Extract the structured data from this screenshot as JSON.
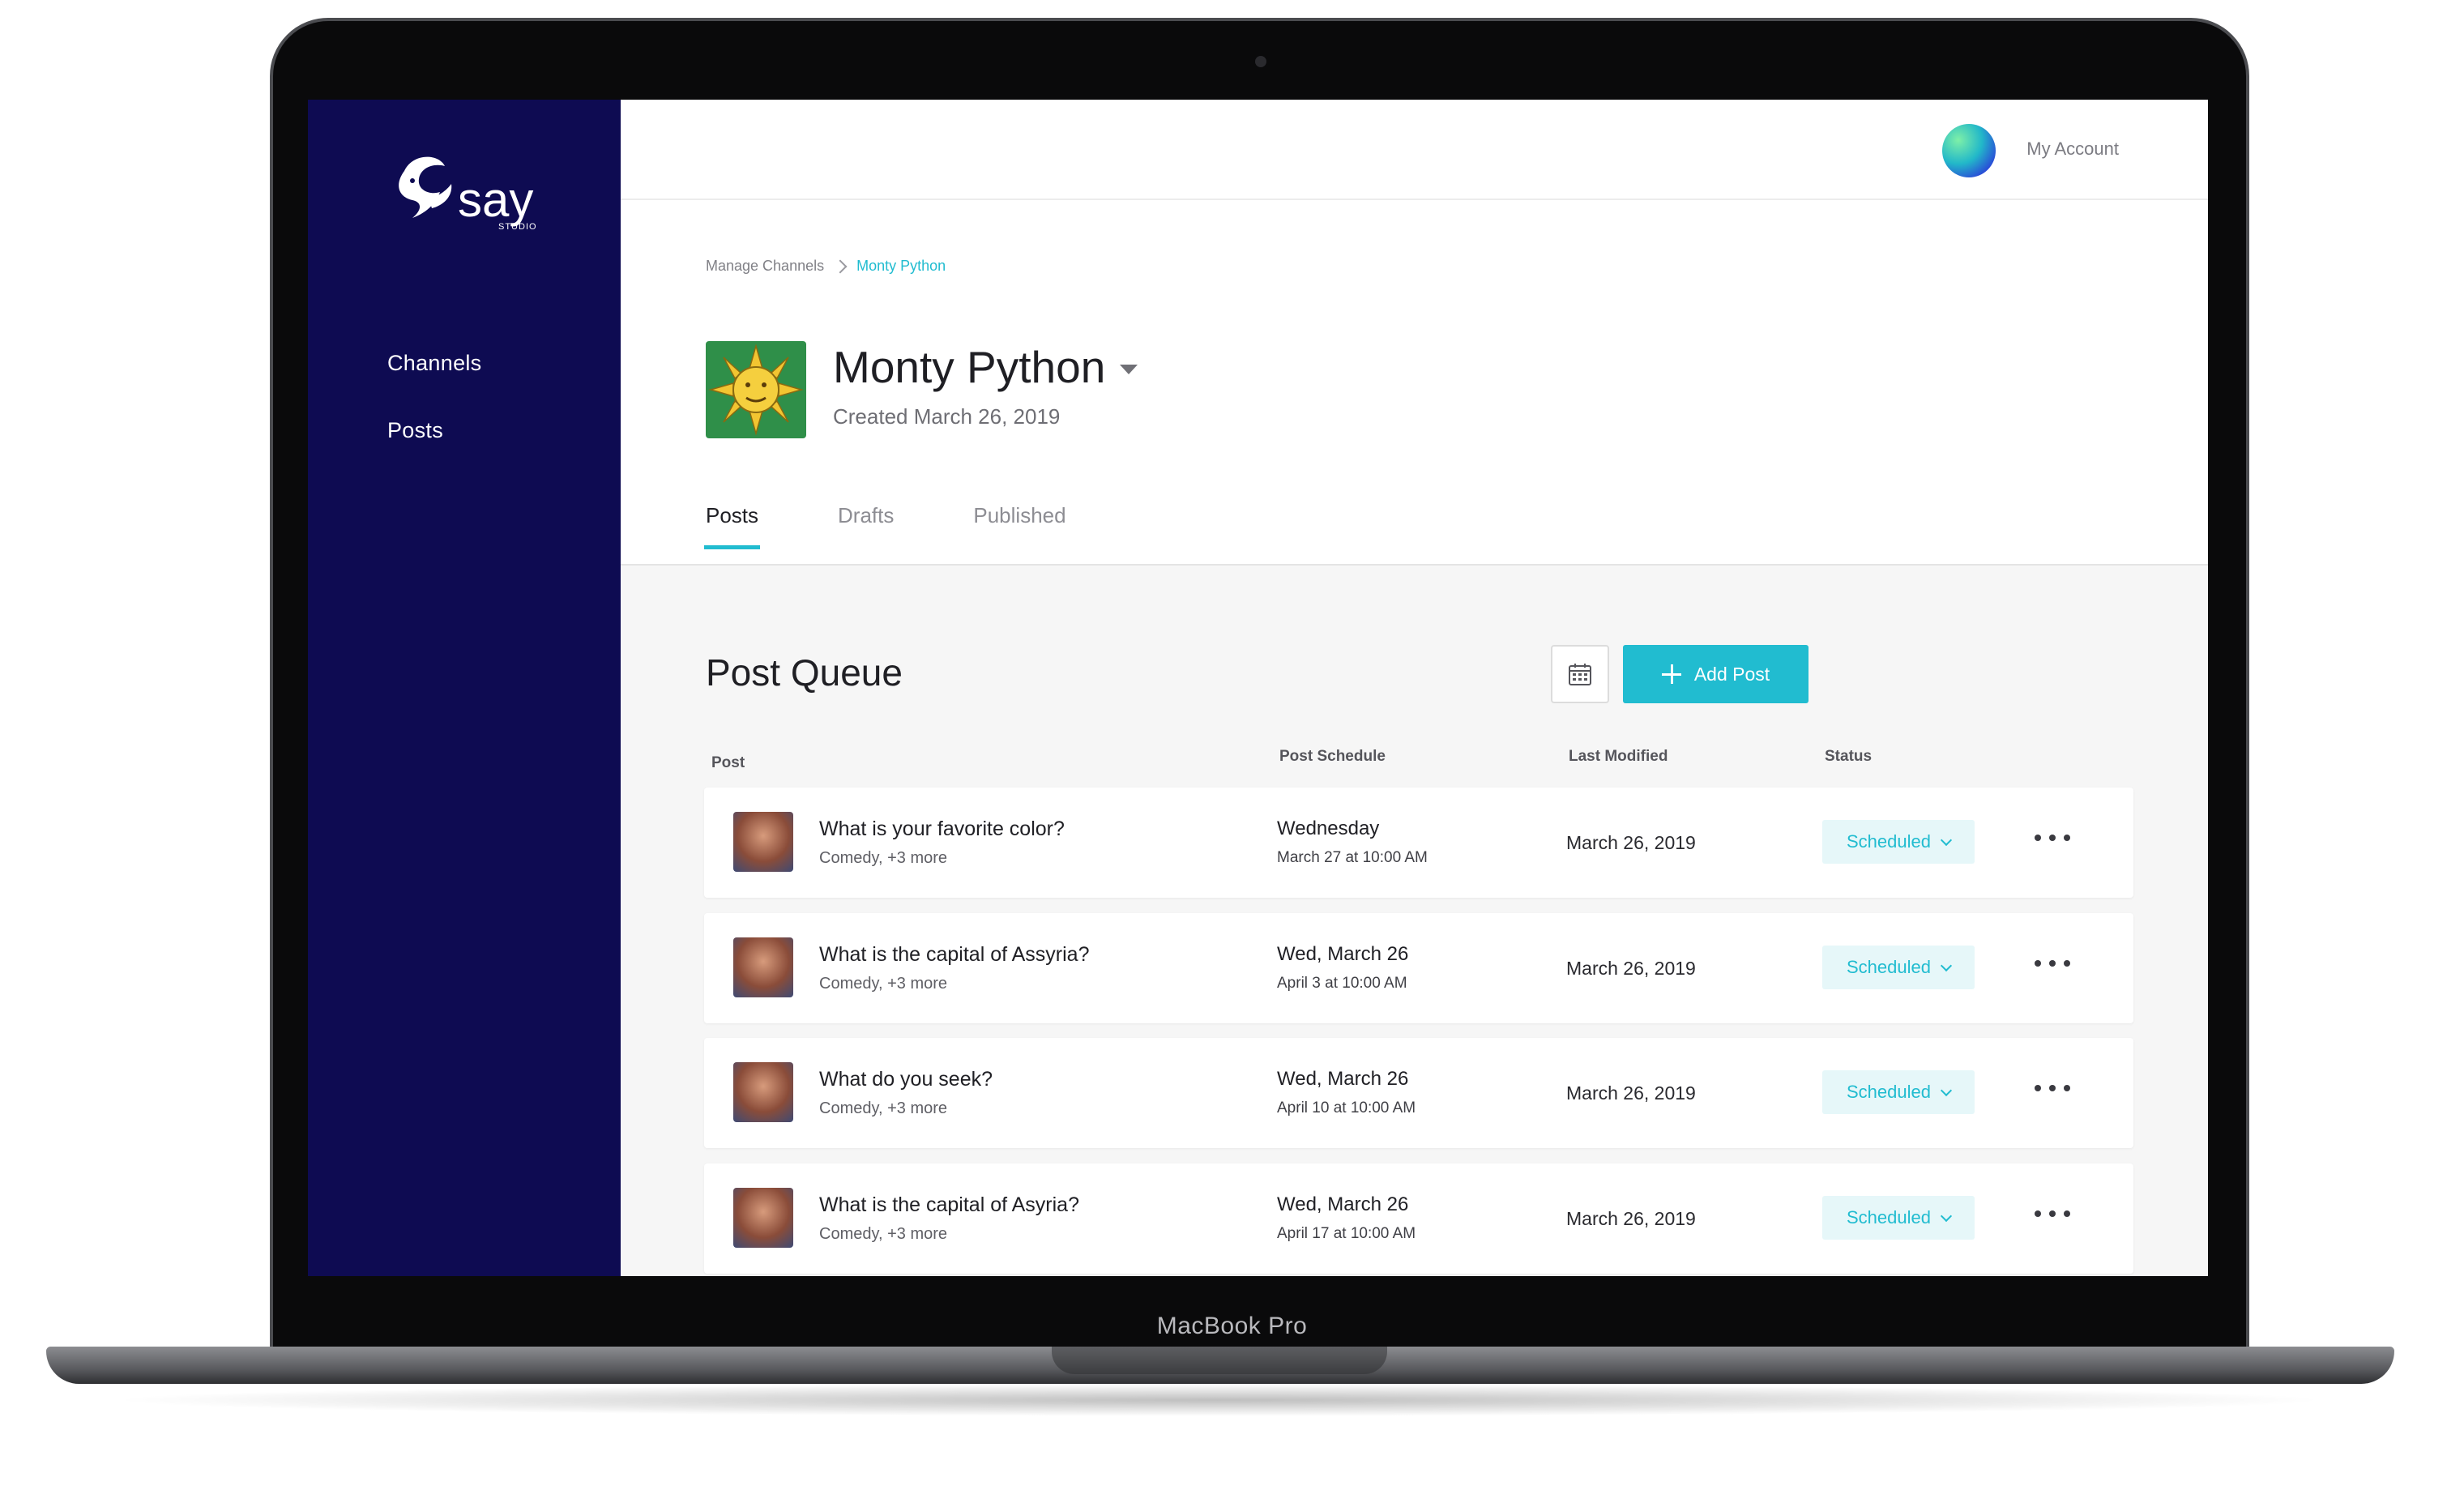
{
  "device": {
    "label": "MacBook Pro"
  },
  "sidebar": {
    "logo": {
      "wordmark": "say",
      "sub": "STUDIO"
    },
    "items": [
      {
        "label": "Channels"
      },
      {
        "label": "Posts"
      }
    ]
  },
  "header": {
    "account_label": "My Account"
  },
  "breadcrumb": {
    "parent": "Manage Channels",
    "current": "Monty Python"
  },
  "channel": {
    "name": "Monty Python",
    "created": "Created March 26, 2019"
  },
  "tabs": [
    {
      "label": "Posts",
      "active": true
    },
    {
      "label": "Drafts"
    },
    {
      "label": "Published"
    }
  ],
  "queue": {
    "title": "Post Queue",
    "add_label": "Add Post",
    "columns": {
      "post": "Post",
      "schedule": "Post Schedule",
      "modified": "Last Modified",
      "status": "Status"
    },
    "rows": [
      {
        "question": "What is your favorite color?",
        "tags": "Comedy, +3 more",
        "sched_day": "Wednesday",
        "sched_time": "March 27 at 10:00 AM",
        "modified": "March 26, 2019",
        "status": "Scheduled"
      },
      {
        "question": "What is the capital of Assyria?",
        "tags": "Comedy, +3 more",
        "sched_day": "Wed, March 26",
        "sched_time": "April 3 at 10:00 AM",
        "modified": "March 26, 2019",
        "status": "Scheduled"
      },
      {
        "question": "What do you seek?",
        "tags": "Comedy, +3 more",
        "sched_day": "Wed, March 26",
        "sched_time": "April 10 at 10:00 AM",
        "modified": "March 26, 2019",
        "status": "Scheduled"
      },
      {
        "question": "What is the capital of Asyria?",
        "tags": "Comedy, +3 more",
        "sched_day": "Wed, March 26",
        "sched_time": "April 17 at 10:00 AM",
        "modified": "March 26, 2019",
        "status": "Scheduled"
      }
    ]
  },
  "colors": {
    "accent": "#21bcd0",
    "sidebar": "#0e0b52",
    "text": "#1f1f24"
  }
}
